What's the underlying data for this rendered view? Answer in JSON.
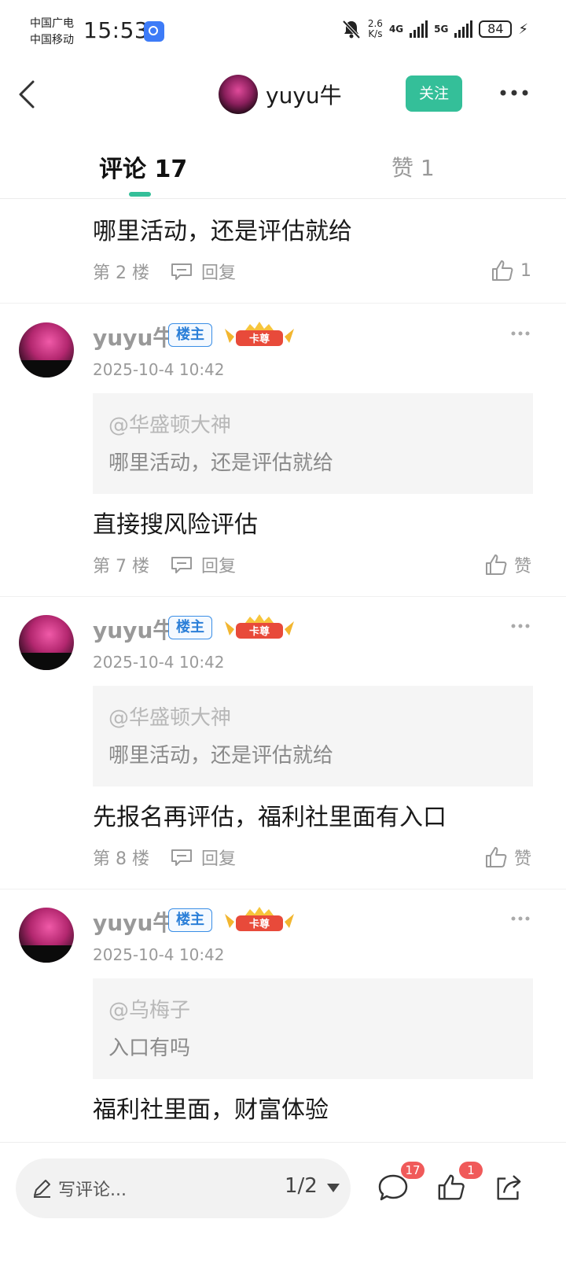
{
  "status_bar": {
    "carrier1": "中国广电",
    "carrier2": "中国移动",
    "time": "15:53",
    "speed_value": "2.6",
    "speed_unit": "K/s",
    "net1": "4G",
    "net2": "5G",
    "battery": "84"
  },
  "header": {
    "author_name": "yuyu牛",
    "follow_label": "关注"
  },
  "tabs": {
    "comments_label": "评论 17",
    "likes_label": "赞 1"
  },
  "partial_comment": {
    "text": "哪里活动，还是评估就给",
    "floor": "第 2 楼",
    "reply_label": "回复",
    "likes": "1"
  },
  "comments": [
    {
      "name": "yuyu牛",
      "op_badge": "楼主",
      "vip_badge": "卡尊",
      "time": "2025-10-4 10:42",
      "quote_user": "@华盛顿大神",
      "quote_text": "哪里活动，还是评估就给",
      "text": "直接搜风险评估",
      "floor": "第 7 楼",
      "reply_label": "回复",
      "like_label": "赞"
    },
    {
      "name": "yuyu牛",
      "op_badge": "楼主",
      "vip_badge": "卡尊",
      "time": "2025-10-4 10:42",
      "quote_user": "@华盛顿大神",
      "quote_text": "哪里活动，还是评估就给",
      "text": "先报名再评估，福利社里面有入口",
      "floor": "第 8 楼",
      "reply_label": "回复",
      "like_label": "赞"
    },
    {
      "name": "yuyu牛",
      "op_badge": "楼主",
      "vip_badge": "卡尊",
      "time": "2025-10-4 10:42",
      "quote_user": "@乌梅子",
      "quote_text": "入口有吗",
      "text": "福利社里面，财富体验"
    }
  ],
  "bottom_bar": {
    "input_placeholder": "写评论...",
    "page_indicator": "1/2",
    "comment_count": "17",
    "like_count": "1"
  },
  "colors": {
    "accent": "#34bf99",
    "badge_red": "#f05a5a",
    "op_badge_blue": "#2b7fd8"
  }
}
